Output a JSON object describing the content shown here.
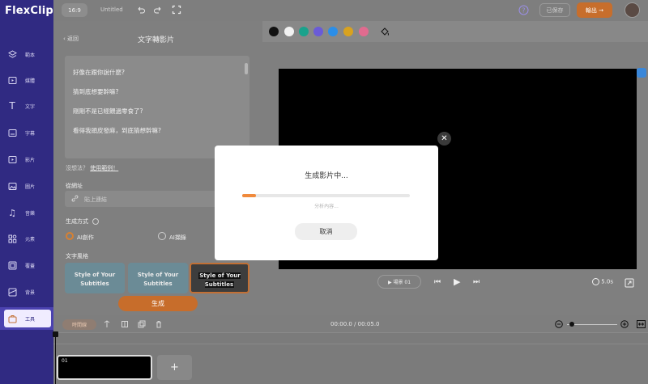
{
  "app": {
    "logo": "FlexClip"
  },
  "topbar": {
    "ratio": "16:9",
    "project_name": "Untitled",
    "saved_label": "已保存",
    "export_label": "輸出 →"
  },
  "sidebar": {
    "items": [
      {
        "label": "範本",
        "icon": "template-icon"
      },
      {
        "label": "媒體",
        "icon": "media-icon"
      },
      {
        "label": "文字",
        "icon": "text-icon"
      },
      {
        "label": "字幕",
        "icon": "subtitle-icon"
      },
      {
        "label": "影片",
        "icon": "video-icon"
      },
      {
        "label": "圖片",
        "icon": "image-icon"
      },
      {
        "label": "音樂",
        "icon": "music-icon"
      },
      {
        "label": "元素",
        "icon": "elements-icon"
      },
      {
        "label": "覆蓋",
        "icon": "overlay-icon"
      },
      {
        "label": "背景",
        "icon": "background-icon"
      },
      {
        "label": "工具",
        "icon": "tools-icon"
      }
    ]
  },
  "panel": {
    "back_label": "返回",
    "title": "文字轉影片",
    "script_lines": [
      "好像在跟你說什麼?",
      "猜到底想要幹嘛?",
      "剛剛不是已經餵過零食了?",
      "看得我頭皮發麻，到底猜想幹嘛?"
    ],
    "sample_text": "沒想法？",
    "sample_link": "使用範例！",
    "url_label": "從網址",
    "url_placeholder": "貼上連結",
    "method_label": "生成方式",
    "method_ai_create": "AI創作",
    "method_ai_extract": "AI擷錄",
    "style_label": "文字風格",
    "style_cards": [
      "Style of Your Subtitles",
      "Style of Your Subtitles",
      "Style of Your Subtitles"
    ],
    "generate_label": "生成"
  },
  "colors": {
    "swatches": [
      "#111111",
      "#f2f2f2",
      "#1aa28c",
      "#6a5bd8",
      "#2b8ee8",
      "#d8a21f",
      "#e16b8f"
    ],
    "accent": "#f08a3c"
  },
  "player": {
    "scene_label": "▶ 場景 01",
    "duration": "5.0s"
  },
  "timeline": {
    "edit_button": "時間線",
    "time_code": "00:00.0 / 00:05.0",
    "clip_label": "01",
    "add_label": "+"
  },
  "modal": {
    "title": "生成影片中...",
    "progress_text": "分析內容...",
    "progress": 0.08,
    "cancel_label": "取消",
    "close_label": "✕"
  }
}
